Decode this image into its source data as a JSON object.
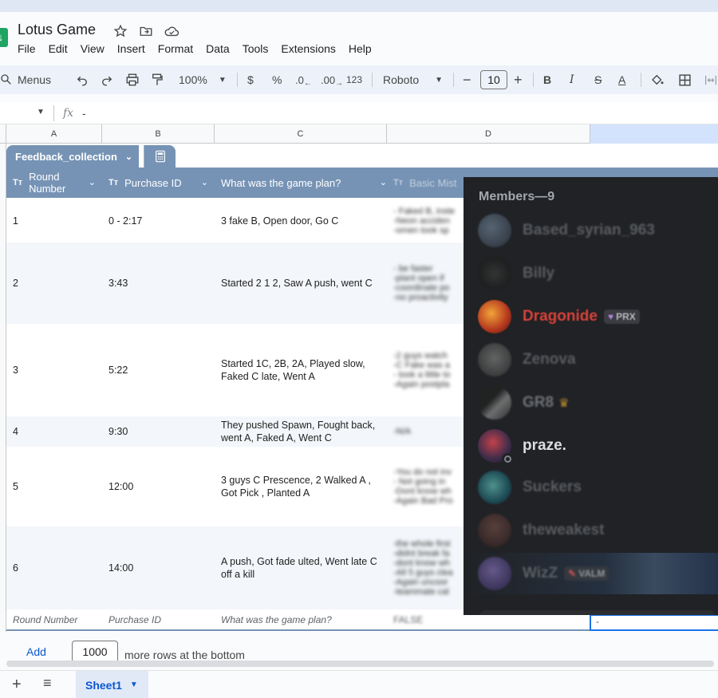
{
  "doc": {
    "title": "Lotus Game"
  },
  "menu": [
    "File",
    "Edit",
    "View",
    "Insert",
    "Format",
    "Data",
    "Tools",
    "Extensions",
    "Help"
  ],
  "toolbar": {
    "menus_label": "Menus",
    "zoom": "100%",
    "currency": "$",
    "percent": "%",
    "dec_decrease": ".0",
    "dec_increase": ".00",
    "number_format": "123",
    "font": "Roboto",
    "font_size": "10",
    "bold": "B",
    "italic": "I",
    "strike": "S",
    "text_color": "A"
  },
  "formula": {
    "fx": "fx",
    "value": "-"
  },
  "columns": [
    "A",
    "B",
    "C",
    "D"
  ],
  "table": {
    "name": "Feedback_collection",
    "type_glyph": "Tт",
    "headers": [
      "Round Number",
      "Purchase ID",
      "What was the game plan?",
      "Basic Mist"
    ],
    "rows": [
      {
        "round": "1",
        "time": "0 - 2:17",
        "plan": "3 fake B, Open door, Go C",
        "notes": [
          "- Faked B, inste",
          "-Neon acciden",
          "-omen took sp"
        ]
      },
      {
        "round": "2",
        "time": "3:43",
        "plan": "Started 2 1 2, Saw A push, went C",
        "notes": [
          "- be faster",
          "-plant open if",
          "-coordinate po",
          "-no proactivity"
        ]
      },
      {
        "round": "3",
        "time": "5:22",
        "plan": "Started 1C, 2B, 2A, Played slow, Faked C late, Went A",
        "notes": [
          "-2 guys watch",
          "-C Fake was a",
          "- took a little to",
          "-Again postpla"
        ]
      },
      {
        "round": "4",
        "time": "9:30",
        "plan": "They pushed Spawn, Fought back, went A, Faked A, Went C",
        "notes": [
          "-N/A"
        ]
      },
      {
        "round": "5",
        "time": "12:00",
        "plan": "3 guys C Prescence,  2 Walked A , Got Pick , Planted A",
        "notes": [
          "-You do not inv",
          "- Not going in",
          "-Dont know wh",
          "-Again Bad Pro"
        ]
      },
      {
        "round": "6",
        "time": "14:00",
        "plan": "A push, Got fade ulted, Went late C off  a kill",
        "notes": [
          "-the whole first",
          "-didnt break fa",
          "-dont know wh",
          "-All 5 guys clea",
          "-Again uncoor",
          "-teammate cal"
        ]
      }
    ],
    "footer": [
      "Round Number",
      "Purchase ID",
      "What was the game plan?",
      "FALSE"
    ]
  },
  "discord": {
    "title": "Members—9",
    "members": [
      {
        "name": "Based_syrian_963"
      },
      {
        "name": "Billy"
      },
      {
        "name": "Dragonide",
        "badge": "PRX"
      },
      {
        "name": "Zenova"
      },
      {
        "name": "GR8"
      },
      {
        "name": "praze."
      },
      {
        "name": "Suckers"
      },
      {
        "name": "theweakest"
      },
      {
        "name": "WizZ",
        "badge": "VALM"
      }
    ]
  },
  "selected_cell_value": "-",
  "add_rows": {
    "button": "Add",
    "count": "1000",
    "suffix": "more rows at the bottom"
  },
  "sheets": {
    "active": "Sheet1"
  },
  "colors": {
    "table_header": "#7693b5",
    "accent": "#0b57d0",
    "discord_bg": "#202225"
  }
}
